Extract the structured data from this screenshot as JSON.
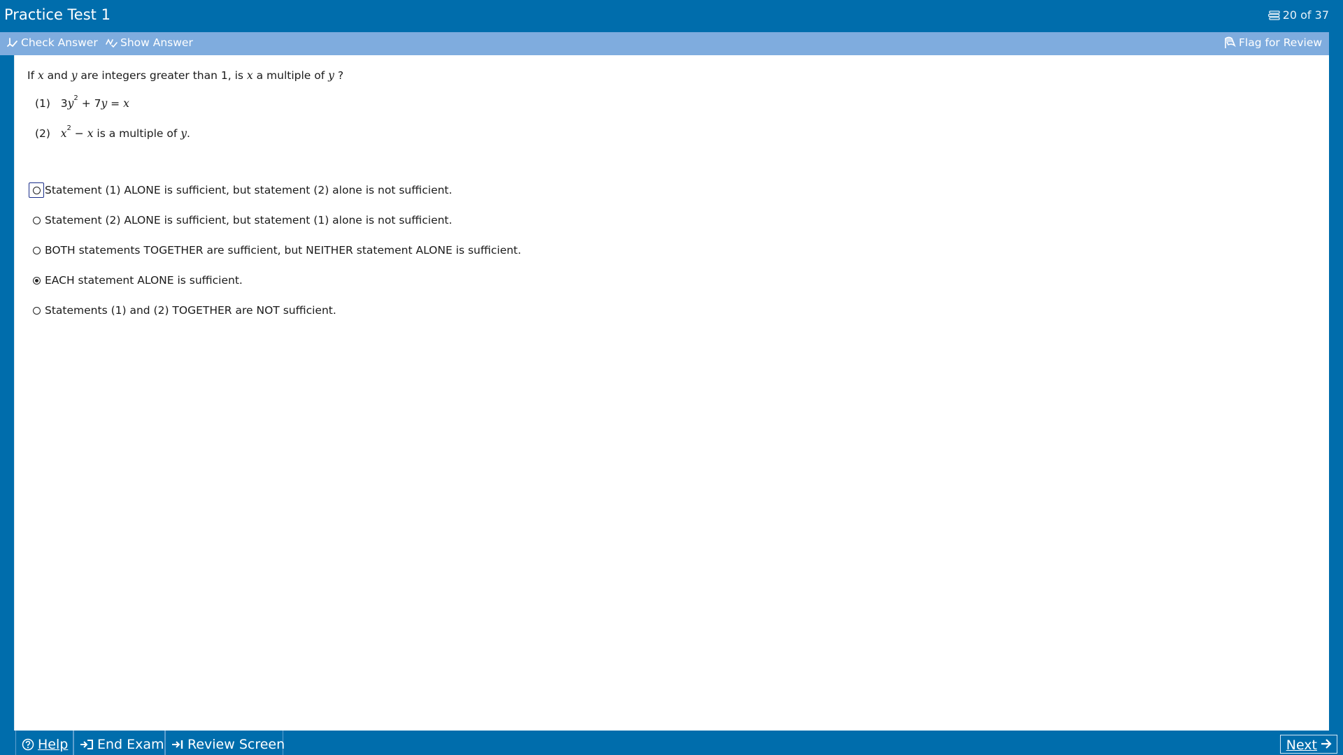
{
  "titlebar": {
    "title": "Practice Test 1",
    "progress": "20 of 37",
    "progress_icon": "question-list-icon"
  },
  "toolbar": {
    "check_answer": "Check Answer",
    "show_answer": "Show Answer",
    "flag_for_review": "Flag for Review"
  },
  "question": {
    "stem_parts": [
      "If ",
      "x",
      " and ",
      "y",
      " are integers greater than 1, is ",
      "x",
      " a multiple of ",
      "y",
      " ?"
    ],
    "statement1": {
      "label": "(1)",
      "parts": [
        "3",
        "y",
        "2",
        " + 7",
        "y",
        " = ",
        "x"
      ]
    },
    "statement2": {
      "label": "(2)",
      "parts": [
        "x",
        "2",
        " − ",
        "x",
        " is a multiple of ",
        "y",
        "."
      ]
    }
  },
  "choices": [
    {
      "text": "Statement (1) ALONE is sufficient, but statement (2) alone is not sufficient.",
      "selected": false,
      "focused": true
    },
    {
      "text": "Statement (2) ALONE is sufficient, but statement (1) alone is not sufficient.",
      "selected": false,
      "focused": false
    },
    {
      "text": "BOTH statements TOGETHER are sufficient, but NEITHER statement ALONE is sufficient.",
      "selected": false,
      "focused": false
    },
    {
      "text": "EACH statement ALONE is sufficient.",
      "selected": true,
      "focused": false
    },
    {
      "text": "Statements (1) and (2) TOGETHER are NOT sufficient.",
      "selected": false,
      "focused": false
    }
  ],
  "bottombar": {
    "help": "Help",
    "end_exam": "End Exam",
    "review_screen": "Review Screen",
    "next": "Next"
  },
  "colors": {
    "frame": "#006dac",
    "toolbar": "#7facde",
    "content": "#ffffff"
  }
}
